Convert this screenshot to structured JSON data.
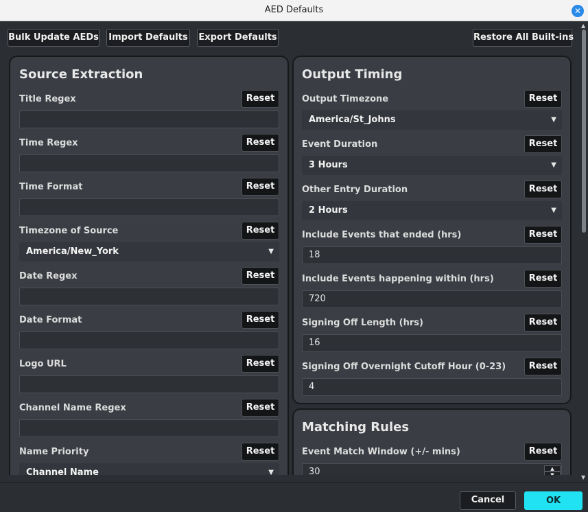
{
  "window": {
    "title": "AED Defaults"
  },
  "toolbar": {
    "bulk_update": "Bulk Update AEDs",
    "import_defaults": "Import Defaults",
    "export_defaults": "Export Defaults",
    "restore_all": "Restore All Built-ins"
  },
  "reset_label": "Reset",
  "source_extraction": {
    "title": "Source Extraction",
    "fields": [
      {
        "label": "Title Regex",
        "value": ""
      },
      {
        "label": "Time Regex",
        "value": ""
      },
      {
        "label": "Time Format",
        "value": ""
      },
      {
        "label": "Timezone of Source",
        "value": "America/New_York"
      },
      {
        "label": "Date Regex",
        "value": ""
      },
      {
        "label": "Date Format",
        "value": ""
      },
      {
        "label": "Logo URL",
        "value": ""
      },
      {
        "label": "Channel Name Regex",
        "value": ""
      },
      {
        "label": "Name Priority",
        "value": "Channel Name"
      }
    ]
  },
  "output_timing": {
    "title": "Output Timing",
    "fields": [
      {
        "label": "Output Timezone",
        "value": "America/St_Johns"
      },
      {
        "label": "Event Duration",
        "value": "3 Hours"
      },
      {
        "label": "Other Entry Duration",
        "value": "2 Hours"
      },
      {
        "label": "Include Events that ended (hrs)",
        "value": "18"
      },
      {
        "label": "Include Events happening within (hrs)",
        "value": "720"
      },
      {
        "label": "Signing Off Length (hrs)",
        "value": "16"
      },
      {
        "label": "Signing Off Overnight Cutoff Hour (0-23)",
        "value": "4"
      }
    ]
  },
  "matching_rules": {
    "title": "Matching Rules",
    "fields": [
      {
        "label": "Event Match Window (+/- mins)",
        "value": "30"
      }
    ]
  },
  "footer": {
    "cancel": "Cancel",
    "ok": "OK"
  },
  "icons": {
    "close": "close-icon",
    "dropdown": "chevron-down-icon",
    "spin_up": "spin-up-icon",
    "spin_down": "spin-down-icon"
  },
  "colors": {
    "accent": "#21e2f2",
    "close_button": "#2a8ae8",
    "panel_bg": "#3a3e44",
    "window_bg": "#2b2e33"
  }
}
